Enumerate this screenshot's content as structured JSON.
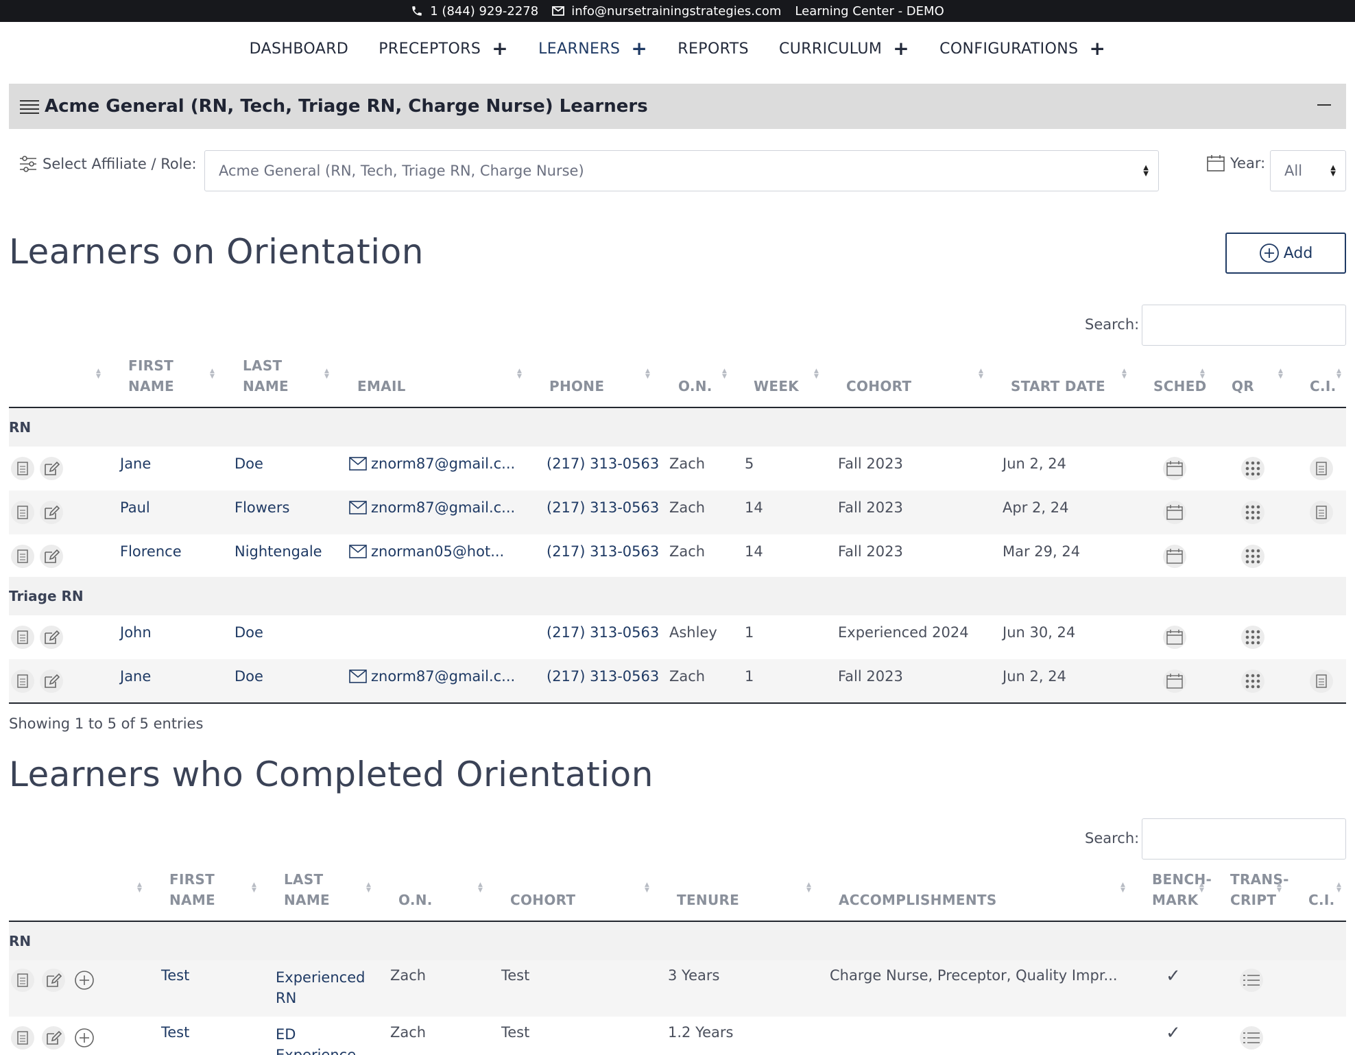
{
  "topbar": {
    "phone": "1 (844) 929-2278",
    "email": "info@nursetrainingstrategies.com",
    "center": "Learning Center - DEMO"
  },
  "nav": {
    "items": [
      {
        "label": "DASHBOARD",
        "plus": ""
      },
      {
        "label": "PRECEPTORS",
        "plus": "+"
      },
      {
        "label": "LEARNERS",
        "plus": "+"
      },
      {
        "label": "REPORTS",
        "plus": ""
      },
      {
        "label": "CURRICULUM",
        "plus": "+"
      },
      {
        "label": "CONFIGURATIONS",
        "plus": "+"
      }
    ],
    "active_index": 2
  },
  "panel": {
    "title": "Acme General (RN, Tech, Triage RN, Charge Nurse) Learners"
  },
  "filters": {
    "affiliate_label": "Select Affiliate / Role:",
    "affiliate_value": "Acme General (RN, Tech, Triage RN, Charge Nurse)",
    "year_label": "Year:",
    "year_value": "All"
  },
  "orientation": {
    "title": "Learners on Orientation",
    "add_label": "Add",
    "search_label": "Search:",
    "columns": {
      "first_name": [
        "FIRST",
        "NAME"
      ],
      "last_name": [
        "LAST",
        "NAME"
      ],
      "email": "EMAIL",
      "phone": "PHONE",
      "on": "O.N.",
      "week": "WEEK",
      "cohort": "COHORT",
      "start_date": "START DATE",
      "sched": "SCHED",
      "qr": "QR",
      "ci": "C.I."
    },
    "groups": [
      {
        "name": "RN",
        "rows": [
          {
            "first": "Jane",
            "last": "Doe",
            "email": "znorm87@gmail.c...",
            "phone": "(217) 313-0563",
            "on": "Zach",
            "week": "5",
            "cohort": "Fall 2023",
            "start": "Jun 2, 24",
            "ci": true
          },
          {
            "first": "Paul",
            "last": "Flowers",
            "email": "znorm87@gmail.c...",
            "phone": "(217) 313-0563",
            "on": "Zach",
            "week": "14",
            "cohort": "Fall 2023",
            "start": "Apr 2, 24",
            "ci": true
          },
          {
            "first": "Florence",
            "last": "Nightengale",
            "email": "znorman05@hot...",
            "phone": "(217) 313-0563",
            "on": "Zach",
            "week": "14",
            "cohort": "Fall 2023",
            "start": "Mar 29, 24",
            "ci": false
          }
        ]
      },
      {
        "name": "Triage RN",
        "rows": [
          {
            "first": "John",
            "last": "Doe",
            "email": "",
            "phone": "(217) 313-0563",
            "on": "Ashley",
            "week": "1",
            "cohort": "Experienced 2024",
            "start": "Jun 30, 24",
            "ci": false
          },
          {
            "first": "Jane",
            "last": "Doe",
            "email": "znorm87@gmail.c...",
            "phone": "(217) 313-0563",
            "on": "Zach",
            "week": "1",
            "cohort": "Fall 2023",
            "start": "Jun 2, 24",
            "ci": true
          }
        ]
      }
    ],
    "footer": "Showing 1 to 5 of 5 entries"
  },
  "completed": {
    "title": "Learners who Completed Orientation",
    "search_label": "Search:",
    "columns": {
      "first_name": [
        "FIRST",
        "NAME"
      ],
      "last_name": [
        "LAST",
        "NAME"
      ],
      "on": "O.N.",
      "cohort": "COHORT",
      "tenure": "TENURE",
      "accomplishments": "ACCOMPLISHMENTS",
      "benchmark": [
        "BENCH-",
        "MARK"
      ],
      "transcript": [
        "TRANS-",
        "CRIPT"
      ],
      "ci": "C.I."
    },
    "groups": [
      {
        "name": "RN",
        "rows": [
          {
            "first": "Test",
            "last": [
              "Experienced",
              "RN"
            ],
            "on": "Zach",
            "cohort": "Test",
            "tenure": "3 Years",
            "accomplishments": "Charge Nurse, Preceptor, Quality Impr...",
            "benchmark": "✓"
          },
          {
            "first": "Test",
            "last": [
              "ED",
              "Experience"
            ],
            "on": "Zach",
            "cohort": "Test",
            "tenure": "1.2 Years",
            "accomplishments": "",
            "benchmark": "✓"
          }
        ]
      }
    ]
  }
}
